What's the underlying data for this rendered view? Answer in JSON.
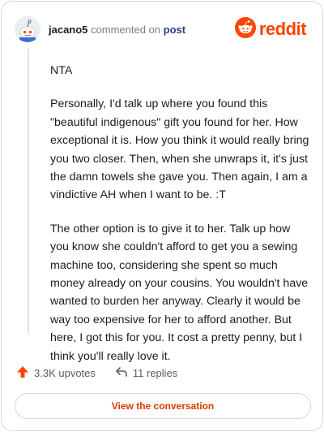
{
  "header": {
    "username": "jacano5",
    "action_text": "commented on",
    "post_link": "post",
    "brand_name": "reddit",
    "avatar_icon": "snoo-avatar-icon",
    "brand_icon": "reddit-alien-logo-icon"
  },
  "comment": {
    "paragraphs": [
      "NTA",
      "Personally, I'd talk up where you found this \"beautiful indigenous\" gift you found for her. How exceptional it is. How you think it would really bring you two closer. Then, when she unwraps it, it's just the damn towels she gave you. Then again, I am a vindictive AH when I want to be. :T",
      "The other option is to give it to her. Talk up how you know she couldn't afford to get you a sewing machine too, considering she spent so much money already on your cousins. You wouldn't have wanted to burden her anyway. Clearly it would be way too expensive for her to afford another. But here, I got this for you. It cost a pretty penny, but I think you'll really love it."
    ]
  },
  "actions": {
    "upvotes": "3.3K upvotes",
    "replies": "11 replies",
    "upvote_icon": "upvote-arrow-icon",
    "reply_icon": "reply-arrow-icon"
  },
  "cta": {
    "label": "View the conversation"
  },
  "colors": {
    "brand": "#ff4500",
    "cta_text": "#d93a00",
    "border": "#d8d8d8"
  }
}
